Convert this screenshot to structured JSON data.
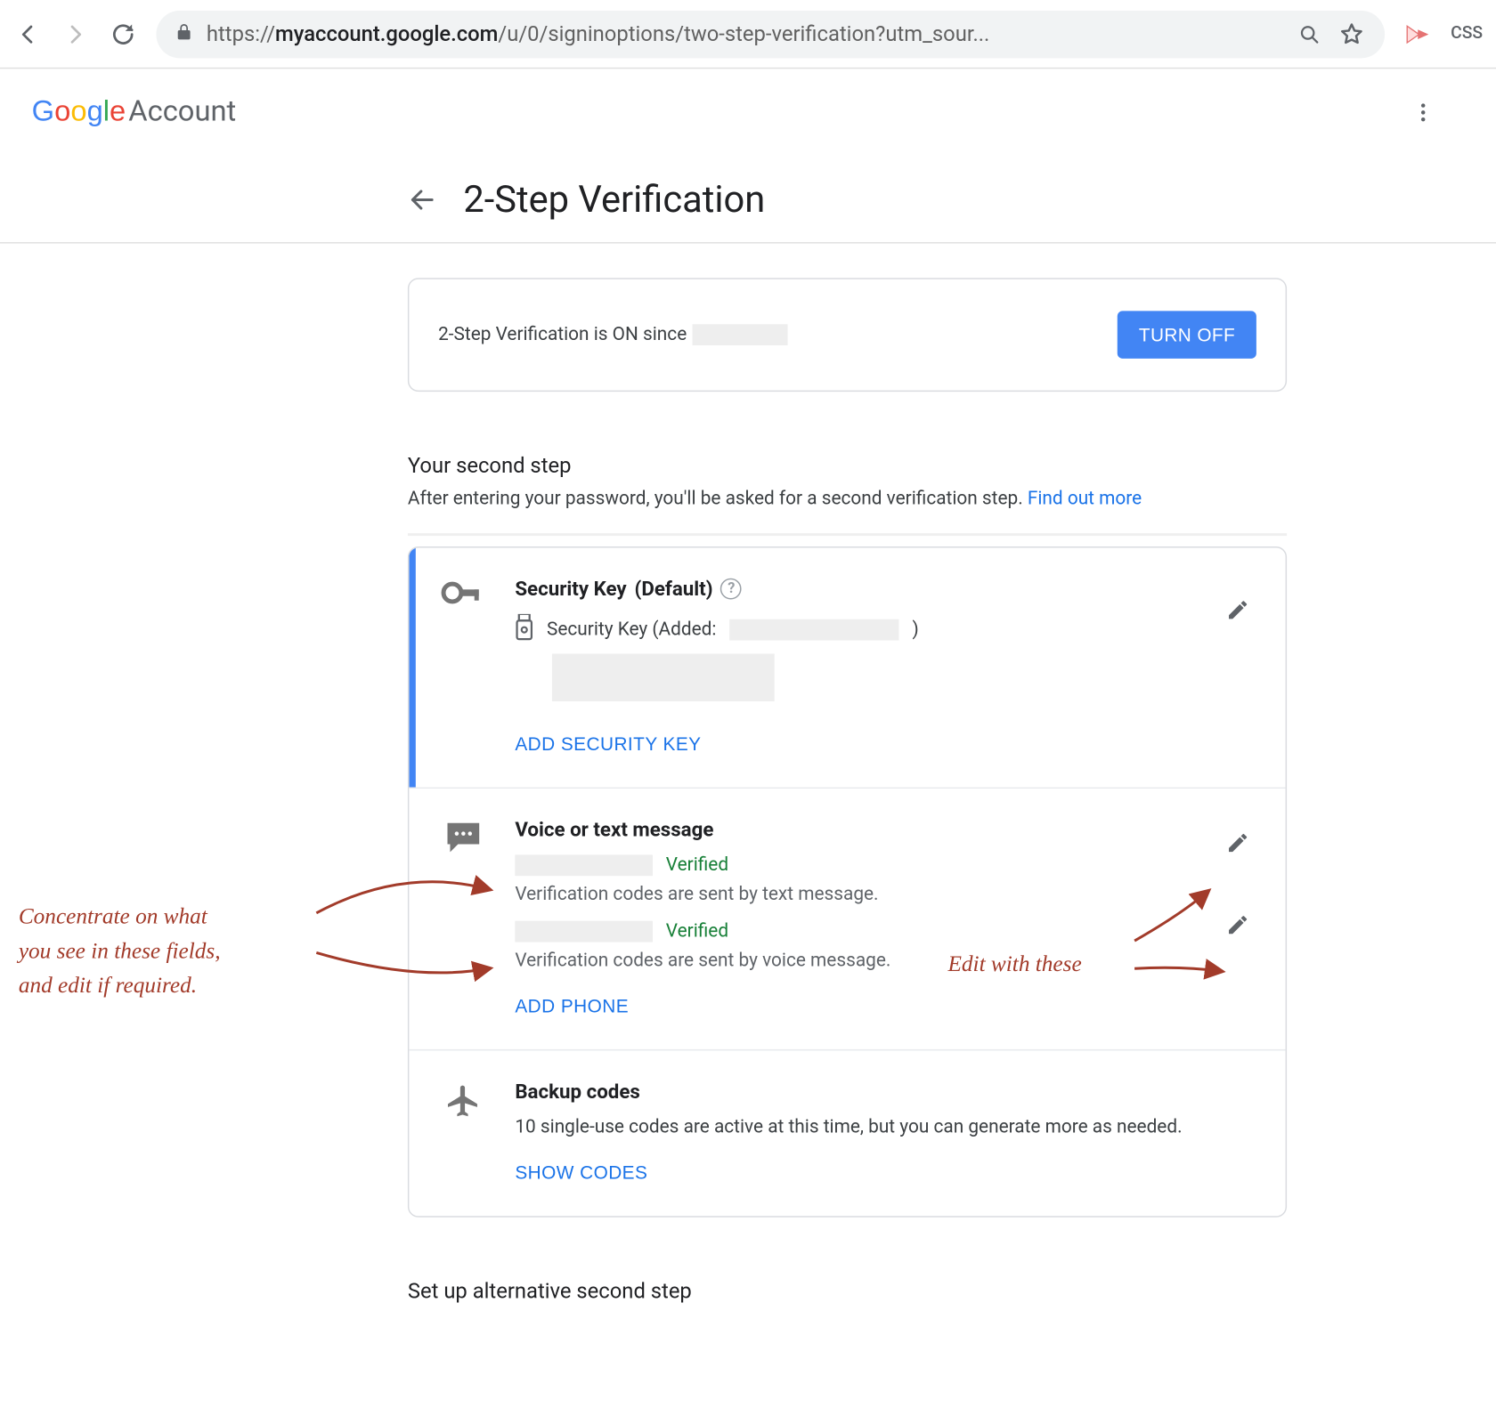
{
  "browser": {
    "url_display": "https://myaccount.google.com/u/0/signinoptions/two-step-verification?utm_sour...",
    "ext_label": "CSS"
  },
  "header": {
    "logo_word": "Google",
    "account_word": "Account"
  },
  "page": {
    "title": "2-Step Verification"
  },
  "status": {
    "text_prefix": "2-Step Verification is ON since",
    "turn_off": "TURN OFF"
  },
  "second_step": {
    "heading": "Your second step",
    "desc_prefix": "After entering your password, you'll be asked for a second verification step. ",
    "link_label": "Find out more"
  },
  "methods": {
    "security_key": {
      "title": "Security Key",
      "default_suffix": "(Default)",
      "added_prefix": "Security Key (Added:",
      "added_suffix": ")",
      "add_label": "ADD SECURITY KEY"
    },
    "voice_text": {
      "title": "Voice or text message",
      "verified_label": "Verified",
      "sent_text": "Verification codes are sent by text message.",
      "sent_voice": "Verification codes are sent by voice message.",
      "add_phone": "ADD PHONE"
    },
    "backup": {
      "title": "Backup codes",
      "desc": "10 single-use codes are active at this time, but you can generate more as needed.",
      "show_label": "SHOW CODES"
    }
  },
  "alt_heading": "Set up alternative second step",
  "annotations": {
    "left_l1": "Concentrate on what",
    "left_l2": "you see in these fields,",
    "left_l3": "and edit if required.",
    "right": "Edit with these"
  }
}
